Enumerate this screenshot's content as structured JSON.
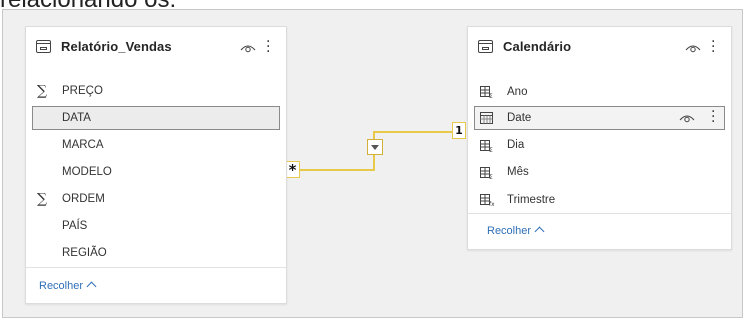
{
  "top_text": "relacionando os:",
  "tables": [
    {
      "title": "Relatório_Vendas",
      "fields": [
        {
          "label": "PREÇO",
          "icon": "sigma-icon"
        },
        {
          "label": "DATA",
          "icon": "none"
        },
        {
          "label": "MARCA",
          "icon": "none"
        },
        {
          "label": "MODELO",
          "icon": "none"
        },
        {
          "label": "ORDEM",
          "icon": "sigma-icon"
        },
        {
          "label": "PAÍS",
          "icon": "none"
        },
        {
          "label": "REGIÃO",
          "icon": "none"
        }
      ],
      "selected": "DATA",
      "collapse": "Recolher"
    },
    {
      "title": "Calendário",
      "fields": [
        {
          "label": "Ano",
          "icon": "calculated-column-icon"
        },
        {
          "label": "Date",
          "icon": "calendar-icon"
        },
        {
          "label": "Dia",
          "icon": "calculated-column-icon"
        },
        {
          "label": "Mês",
          "icon": "calculated-column-icon"
        },
        {
          "label": "Trimestre",
          "icon": "calculated-column-icon"
        }
      ],
      "selected": "Date",
      "collapse": "Recolher"
    }
  ],
  "relationship": {
    "many_side": "*",
    "one_side": "1",
    "filter_direction": "single",
    "line_color": "#e8c94a"
  },
  "colors": {
    "accent_link": "#2f6fb7",
    "canvas": "#f0f0f0"
  }
}
